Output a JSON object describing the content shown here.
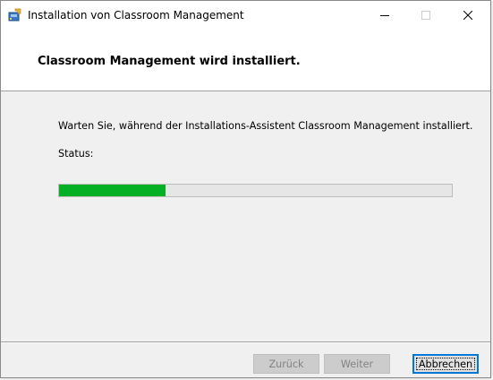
{
  "window": {
    "title": "Installation von Classroom Management",
    "icon": "installer-icon"
  },
  "header": {
    "title": "Classroom Management wird installiert."
  },
  "body": {
    "message": "Warten Sie, während der Installations-Assistent Classroom Management installiert.",
    "status_label": "Status:",
    "progress_fraction": 0.27
  },
  "buttons": {
    "back": {
      "label": "Zurück",
      "enabled": false
    },
    "next": {
      "label": "Weiter",
      "enabled": false
    },
    "cancel": {
      "label": "Abbrechen",
      "enabled": true
    }
  },
  "colors": {
    "progress_fill": "#06b025",
    "progress_track": "#e6e6e6",
    "focus_border": "#0078d7"
  }
}
